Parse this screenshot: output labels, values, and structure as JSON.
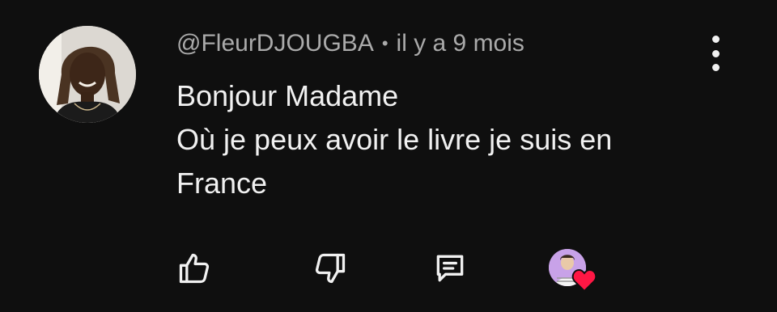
{
  "comment": {
    "author": "@FleurDJOUGBA",
    "separator": "•",
    "time": "il y a 9 mois",
    "lines": [
      "Bonjour Madame",
      "Où je peux avoir le livre je suis en",
      "France"
    ]
  },
  "actions": {
    "like_icon": "thumbs-up-icon",
    "dislike_icon": "thumbs-down-icon",
    "reply_icon": "comment-icon",
    "menu_icon": "more-vertical-icon",
    "creator_heart_icon": "creator-heart-icon"
  },
  "colors": {
    "background": "#0f0f0f",
    "text": "#f1f1f1",
    "meta": "#aaaaaa",
    "heart": "#ff1744"
  }
}
